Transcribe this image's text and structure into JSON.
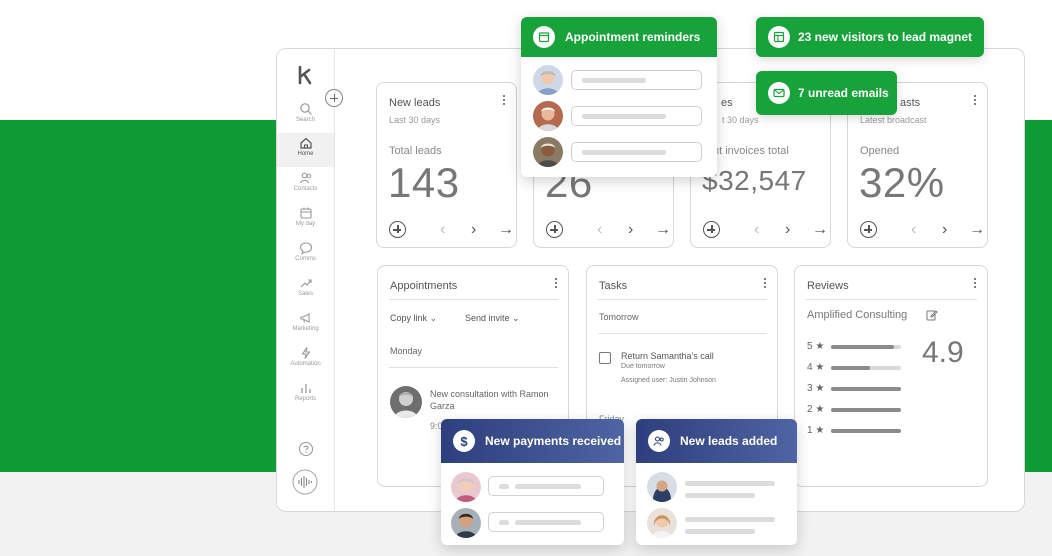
{
  "colors": {
    "brand_green": "#0f9a36",
    "popup_green": "#17a33a",
    "popup_blue": "#3a4f8c"
  },
  "sidebar": {
    "logo_icon": "k-logo-icon",
    "items": [
      {
        "label": "Search",
        "icon": "search-icon"
      },
      {
        "label": "Home",
        "icon": "home-icon"
      },
      {
        "label": "Contacts",
        "icon": "contacts-icon"
      },
      {
        "label": "My day",
        "icon": "calendar-icon"
      },
      {
        "label": "Comms",
        "icon": "chat-icon"
      },
      {
        "label": "Sales",
        "icon": "sales-icon"
      },
      {
        "label": "Marketing",
        "icon": "megaphone-icon"
      },
      {
        "label": "Automation",
        "icon": "lightning-icon"
      },
      {
        "label": "Reports",
        "icon": "bar-chart-icon"
      }
    ],
    "help_icon": "help-icon",
    "voice_icon": "voice-icon"
  },
  "cards": [
    {
      "title": "New leads",
      "sub": "Last 30 days",
      "metric_label": "Total leads",
      "metric": "143"
    },
    {
      "title": "",
      "sub": "",
      "metric_label": "",
      "metric": "26"
    },
    {
      "title": "es",
      "sub": "t 30 days",
      "metric_label": "nt invoices total",
      "metric": "$32,547"
    },
    {
      "title": "asts",
      "sub": "Latest broadcast",
      "metric_label": "Opened",
      "metric": "32%"
    }
  ],
  "appointments": {
    "title": "Appointments",
    "copy_link": "Copy link",
    "send_invite": "Send invite",
    "day": "Monday",
    "item_text": "New consultation with Ramon Garza",
    "item_time": "9:0"
  },
  "tasks": {
    "title": "Tasks",
    "group": "Tomorrow",
    "task_title": "Return Samantha's call",
    "task_due": "Due tomorrow",
    "task_assignee": "Assigned user: Justin Johnson",
    "next_group": "Friday"
  },
  "reviews": {
    "title": "Reviews",
    "business": "Amplified Consulting",
    "score": "4.9",
    "rows": [
      {
        "label": "5 ★",
        "fill": 0.9
      },
      {
        "label": "4 ★",
        "fill": 0.55
      },
      {
        "label": "3 ★",
        "fill": 1
      },
      {
        "label": "2 ★",
        "fill": 1
      },
      {
        "label": "1 ★",
        "fill": 1
      }
    ]
  },
  "popups": {
    "appointment_reminders": "Appointment reminders",
    "visitors": "23 new visitors to lead magnet",
    "emails": "7 unread emails",
    "payments": "New payments received",
    "leads_added": "New leads added"
  }
}
